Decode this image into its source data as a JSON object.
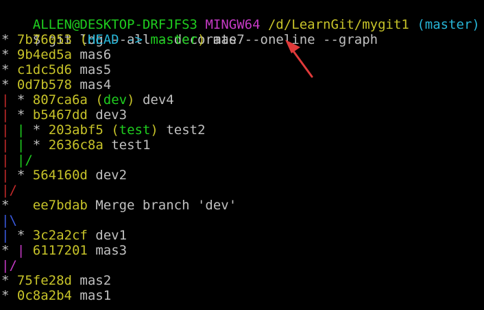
{
  "colors": {
    "background": "#000000",
    "default": "#c0c0c0",
    "green": "#1fce1f",
    "magenta": "#c53ac5",
    "yellow": "#c7c329",
    "cyan": "#27b5d7",
    "red": "#c52a2a",
    "blue": "#3a5ae0",
    "annotation_arrow": "#e03a3a"
  },
  "terminal": {
    "prompt": {
      "user_host": "ALLEN@DESKTOP-DRFJFS3",
      "shell": "MINGW64",
      "path": "/d/LearnGit/mygit1",
      "branch": "(master)"
    },
    "command_line": {
      "symbol": "$",
      "command": "git log --all --decorate --oneline --graph"
    },
    "log_lines": [
      [
        {
          "t": "* ",
          "c": "default"
        },
        {
          "t": "7b76053",
          "c": "yellow"
        },
        {
          "t": " (",
          "c": "yellow"
        },
        {
          "t": "HEAD -> ",
          "c": "cyan"
        },
        {
          "t": "master",
          "c": "green"
        },
        {
          "t": ")",
          "c": "yellow"
        },
        {
          "t": " mas7",
          "c": "default"
        }
      ],
      [
        {
          "t": "* ",
          "c": "default"
        },
        {
          "t": "9b4ed5a",
          "c": "yellow"
        },
        {
          "t": " mas6",
          "c": "default"
        }
      ],
      [
        {
          "t": "* ",
          "c": "default"
        },
        {
          "t": "c1dc5d6",
          "c": "yellow"
        },
        {
          "t": " mas5",
          "c": "default"
        }
      ],
      [
        {
          "t": "* ",
          "c": "default"
        },
        {
          "t": "0d7b578",
          "c": "yellow"
        },
        {
          "t": " mas4",
          "c": "default"
        }
      ],
      [
        {
          "t": "|",
          "c": "red"
        },
        {
          "t": " * ",
          "c": "default"
        },
        {
          "t": "807ca6a",
          "c": "yellow"
        },
        {
          "t": " (",
          "c": "yellow"
        },
        {
          "t": "dev",
          "c": "green"
        },
        {
          "t": ")",
          "c": "yellow"
        },
        {
          "t": " dev4",
          "c": "default"
        }
      ],
      [
        {
          "t": "|",
          "c": "red"
        },
        {
          "t": " * ",
          "c": "default"
        },
        {
          "t": "b5467dd",
          "c": "yellow"
        },
        {
          "t": " dev3",
          "c": "default"
        }
      ],
      [
        {
          "t": "|",
          "c": "red"
        },
        {
          "t": " ",
          "c": "default"
        },
        {
          "t": "|",
          "c": "green"
        },
        {
          "t": " * ",
          "c": "default"
        },
        {
          "t": "203abf5",
          "c": "yellow"
        },
        {
          "t": " (",
          "c": "yellow"
        },
        {
          "t": "test",
          "c": "green"
        },
        {
          "t": ")",
          "c": "yellow"
        },
        {
          "t": " test2",
          "c": "default"
        }
      ],
      [
        {
          "t": "|",
          "c": "red"
        },
        {
          "t": " ",
          "c": "default"
        },
        {
          "t": "|",
          "c": "green"
        },
        {
          "t": " * ",
          "c": "default"
        },
        {
          "t": "2636c8a",
          "c": "yellow"
        },
        {
          "t": " test1",
          "c": "default"
        }
      ],
      [
        {
          "t": "|",
          "c": "red"
        },
        {
          "t": " ",
          "c": "default"
        },
        {
          "t": "|/",
          "c": "green"
        }
      ],
      [
        {
          "t": "|",
          "c": "red"
        },
        {
          "t": " * ",
          "c": "default"
        },
        {
          "t": "564160d",
          "c": "yellow"
        },
        {
          "t": " dev2",
          "c": "default"
        }
      ],
      [
        {
          "t": "|/",
          "c": "red"
        }
      ],
      [
        {
          "t": "*   ",
          "c": "default"
        },
        {
          "t": "ee7bdab",
          "c": "yellow"
        },
        {
          "t": " Merge branch 'dev'",
          "c": "default"
        }
      ],
      [
        {
          "t": "|\\",
          "c": "blue"
        }
      ],
      [
        {
          "t": "|",
          "c": "blue"
        },
        {
          "t": " * ",
          "c": "default"
        },
        {
          "t": "3c2a2cf",
          "c": "yellow"
        },
        {
          "t": " dev1",
          "c": "default"
        }
      ],
      [
        {
          "t": "* ",
          "c": "default"
        },
        {
          "t": "|",
          "c": "magenta"
        },
        {
          "t": " ",
          "c": "default"
        },
        {
          "t": "6117201",
          "c": "yellow"
        },
        {
          "t": " mas3",
          "c": "default"
        }
      ],
      [
        {
          "t": "|/",
          "c": "magenta"
        }
      ],
      [
        {
          "t": "* ",
          "c": "default"
        },
        {
          "t": "75fe28d",
          "c": "yellow"
        },
        {
          "t": " mas2",
          "c": "default"
        }
      ],
      [
        {
          "t": "* ",
          "c": "default"
        },
        {
          "t": "0c8a2b4",
          "c": "yellow"
        },
        {
          "t": " mas1",
          "c": "default"
        }
      ]
    ]
  }
}
